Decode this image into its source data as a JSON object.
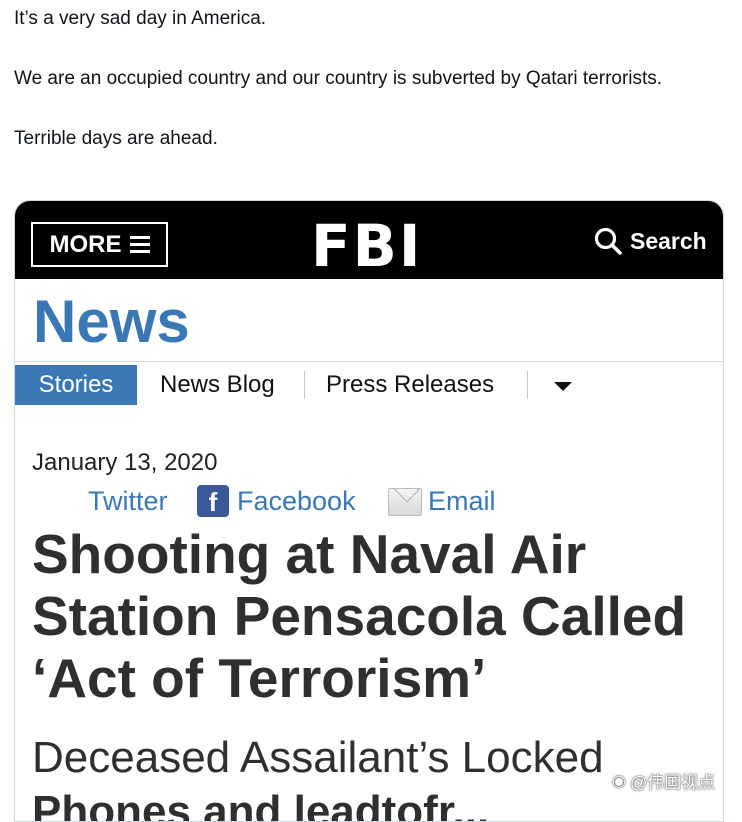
{
  "tweet": {
    "line1": "It’s a very sad day in America.",
    "line2": "We are an occupied country and our country is subverted by Qatari terrorists.",
    "line3": "Terrible days are ahead."
  },
  "fbi_page": {
    "header": {
      "more_label": "MORE",
      "logo": "FBI",
      "search_label": "Search"
    },
    "section_title": "News",
    "tabs": [
      "Stories",
      "News Blog",
      "Press Releases"
    ],
    "date": "January 13, 2020",
    "share": {
      "twitter": "Twitter",
      "facebook_icon": "f",
      "facebook": "Facebook",
      "email": "Email"
    },
    "headline": "Shooting at Naval Air Station Pensacola Called ‘Act of Terrorism’",
    "subheadline": "Deceased Assailant’s Locked",
    "subheadline_partial": "Phones and leadtofr..."
  },
  "watermark": {
    "text": "@伟国视点",
    "icon": "weibo-icon"
  },
  "colors": {
    "fbi_blue": "#3a78b5",
    "header_bg": "#000000",
    "facebook_blue": "#3b5998"
  }
}
